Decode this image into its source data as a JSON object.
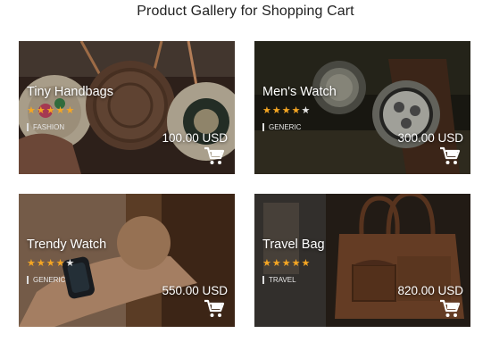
{
  "page": {
    "title": "Product Gallery for Shopping Cart"
  },
  "products": [
    {
      "name": "Tiny Handbags",
      "rating": 5,
      "rating_max": 5,
      "category": "FASHION",
      "price": "100.00 USD",
      "image": "woven-round-handbags-photo"
    },
    {
      "name": "Men's Watch",
      "rating": 4,
      "rating_max": 5,
      "category": "GENERIC",
      "price": "300.00 USD",
      "image": "chronograph-wristwatches-photo"
    },
    {
      "name": "Trendy Watch",
      "rating": 4,
      "rating_max": 5,
      "category": "GENERIC",
      "price": "550.00 USD",
      "image": "smartwatch-on-wrist-photo"
    },
    {
      "name": "Travel Bag",
      "rating": 5,
      "rating_max": 5,
      "category": "TRAVEL",
      "price": "820.00 USD",
      "image": "leather-travel-bag-photo"
    }
  ],
  "icons": {
    "cart": "shopping-cart-icon",
    "star": "star-icon"
  },
  "colors": {
    "star_filled": "#f5a623",
    "star_empty": "#e6e6e6",
    "text_on_image": "#ffffff"
  }
}
